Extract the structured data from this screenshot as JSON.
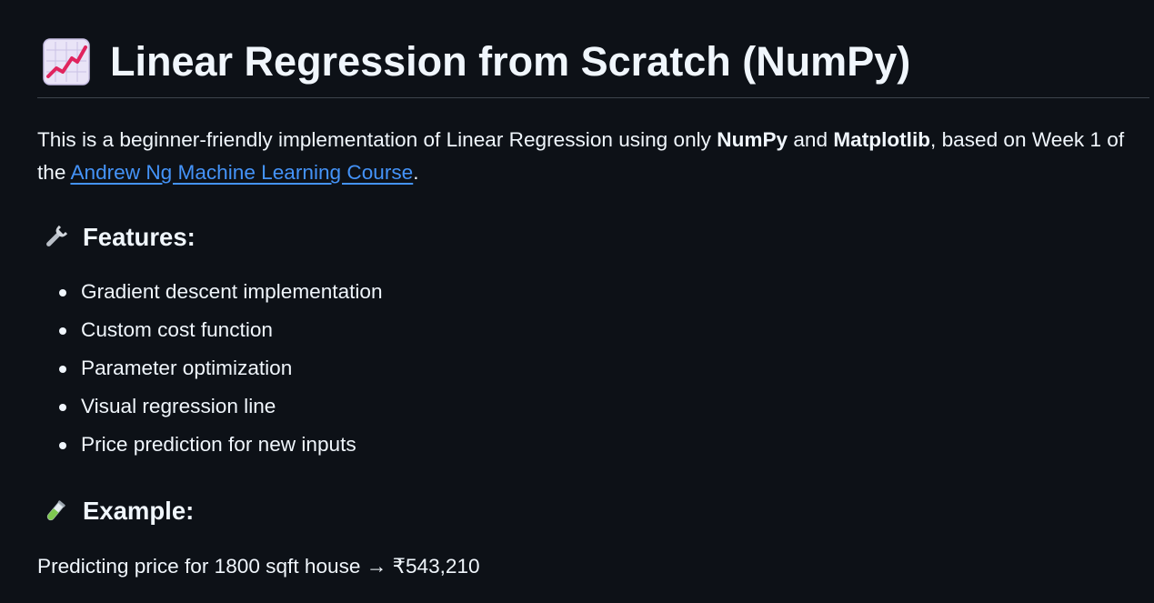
{
  "title": {
    "icon": "chart-increasing-icon",
    "text": "Linear Regression from Scratch (NumPy)"
  },
  "intro": {
    "prefix": "This is a beginner-friendly implementation of Linear Regression using only ",
    "bold1": "NumPy",
    "mid": " and ",
    "bold2": "Matplotlib",
    "after": ", based on Week 1 of the ",
    "link_text": "Andrew Ng Machine Learning Course",
    "suffix": "."
  },
  "features": {
    "icon": "wrench-icon",
    "heading": "Features:",
    "items": [
      "Gradient descent implementation",
      "Custom cost function",
      "Parameter optimization",
      "Visual regression line",
      "Price prediction for new inputs"
    ]
  },
  "example": {
    "icon": "test-tube-icon",
    "heading": "Example:",
    "text": "Predicting price for 1800 sqft house → ₹543,210"
  },
  "colors": {
    "background": "#0d1117",
    "text": "#f0f6fc",
    "link": "#4493f8",
    "divider": "#3d444d"
  }
}
